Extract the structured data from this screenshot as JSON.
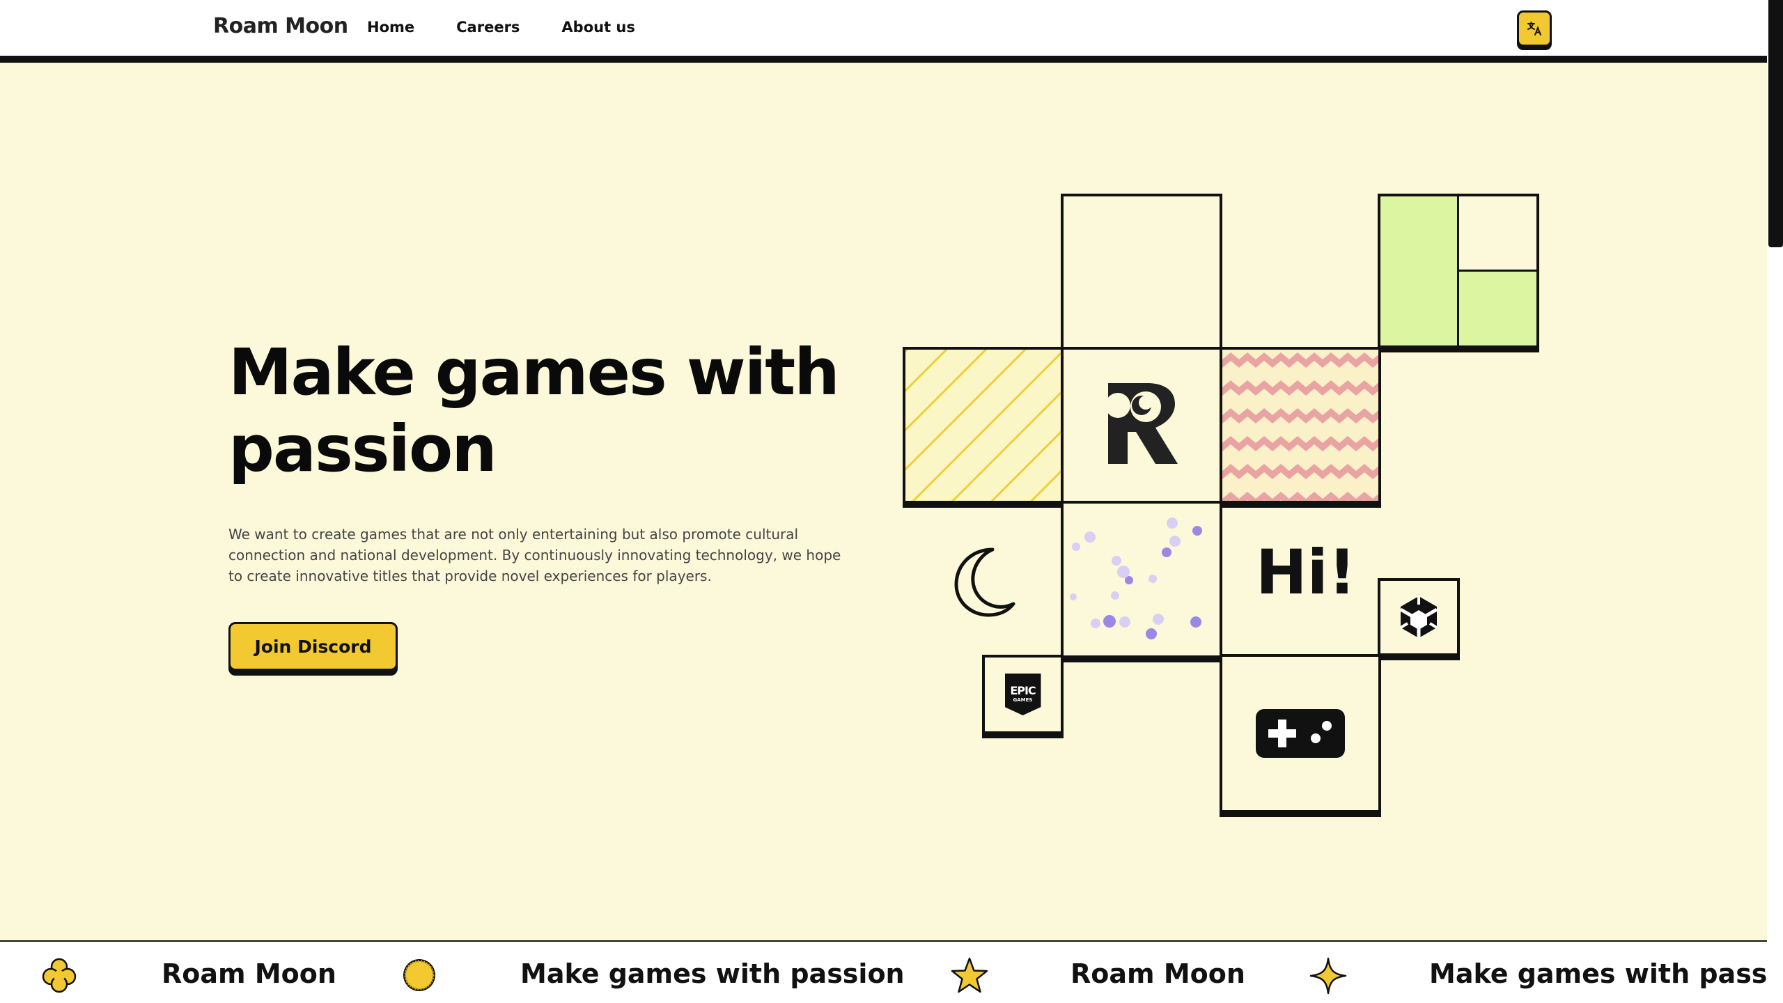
{
  "header": {
    "logo": "Roam Moon",
    "nav": [
      "Home",
      "Careers",
      "About us"
    ],
    "language_icon": "translate-icon"
  },
  "hero": {
    "title_line1": "Make games with",
    "title_line2": "passion",
    "description": "We want to create games that are not only entertaining but also promote cultural connection and national development. By continuously innovating technology, we hope to create innovative titles that provide novel experiences for players.",
    "cta_label": "Join Discord",
    "hi_text": "Hi!",
    "epic_line1": "EPIC",
    "epic_line2": "GAMES"
  },
  "marquee": {
    "items": [
      "Roam Moon",
      "Make games with passion",
      "Roam Moon",
      "Make games with passio"
    ],
    "icons": [
      "clover-icon",
      "sun-icon",
      "star-icon",
      "sparkle-icon"
    ]
  },
  "colors": {
    "accent": "#f2c931",
    "hero_bg": "#fcf9da",
    "lime": "#dcf5a0",
    "pink": "#eaa3a3",
    "purple": "#9b87e6"
  }
}
